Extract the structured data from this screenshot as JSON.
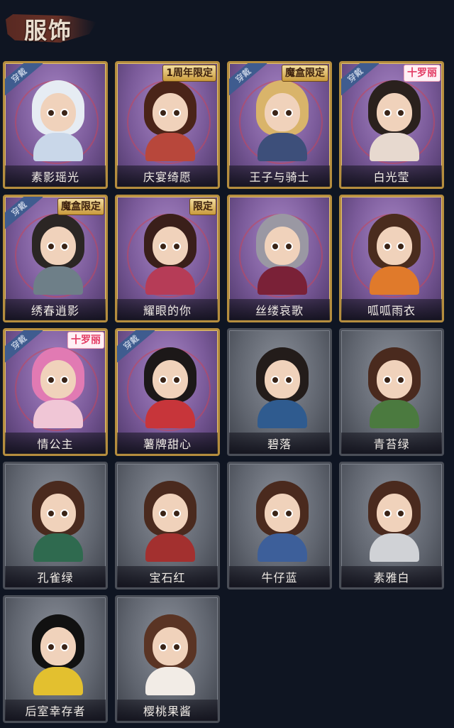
{
  "header": {
    "title": "服饰"
  },
  "labels": {
    "worn": "穿戴"
  },
  "colors": {
    "owned_frame": "#b58d3e",
    "locked_frame": "#4a4e57",
    "worn_ribbon": "#3f5c8f"
  },
  "costumes": [
    {
      "name": "素影瑶光",
      "worn": true,
      "tag": "",
      "state": "owned",
      "hair": "#e6ecf3",
      "body": "#c9d7e9"
    },
    {
      "name": "庆宴绮愿",
      "worn": false,
      "tag": "1周年限定",
      "state": "owned",
      "hair": "#4a2418",
      "body": "#b8473b"
    },
    {
      "name": "王子与骑士",
      "worn": true,
      "tag": "魔盒限定",
      "state": "owned",
      "hair": "#d9b46a",
      "body": "#3d4f7a"
    },
    {
      "name": "白光莹",
      "worn": true,
      "tag": "十罗丽",
      "state": "owned",
      "hair": "#2a211d",
      "body": "#e7d9cf"
    },
    {
      "name": "绣春逍影",
      "worn": true,
      "tag": "魔盒限定",
      "state": "owned",
      "hair": "#2b2624",
      "body": "#6e7f88"
    },
    {
      "name": "耀眼的你",
      "worn": false,
      "tag": "限定",
      "state": "owned",
      "hair": "#3a1f1a",
      "body": "#b63c57"
    },
    {
      "name": "丝缕哀歌",
      "worn": false,
      "tag": "",
      "state": "owned",
      "hair": "#9a98a3",
      "body": "#7a2137"
    },
    {
      "name": "呱呱雨衣",
      "worn": false,
      "tag": "",
      "state": "owned",
      "hair": "#4a2c1e",
      "body": "#e07a2b"
    },
    {
      "name": "情公主",
      "worn": true,
      "tag": "十罗丽",
      "state": "owned",
      "hair": "#e17ab3",
      "body": "#f0c6d6"
    },
    {
      "name": "薯牌甜心",
      "worn": true,
      "tag": "",
      "state": "owned",
      "hair": "#1c1818",
      "body": "#c7353a"
    },
    {
      "name": "碧落",
      "worn": false,
      "tag": "",
      "state": "locked",
      "hair": "#231c1a",
      "body": "#2f5b8f"
    },
    {
      "name": "青苔绿",
      "worn": false,
      "tag": "",
      "state": "locked",
      "hair": "#4a2a1e",
      "body": "#4b7a3f"
    },
    {
      "name": "孔雀绿",
      "worn": false,
      "tag": "",
      "state": "locked",
      "hair": "#4a2a1e",
      "body": "#2f6a4f"
    },
    {
      "name": "宝石红",
      "worn": false,
      "tag": "",
      "state": "locked",
      "hair": "#4a2a1e",
      "body": "#a3302f"
    },
    {
      "name": "牛仔蓝",
      "worn": false,
      "tag": "",
      "state": "locked",
      "hair": "#4a2a1e",
      "body": "#3d5f9a"
    },
    {
      "name": "素雅白",
      "worn": false,
      "tag": "",
      "state": "locked",
      "hair": "#4a2a1e",
      "body": "#d0d2d6"
    },
    {
      "name": "后室幸存者",
      "worn": false,
      "tag": "",
      "state": "locked",
      "hair": "#111111",
      "body": "#e3c02f"
    },
    {
      "name": "樱桃果酱",
      "worn": false,
      "tag": "",
      "state": "locked",
      "hair": "#5a3424",
      "body": "#f2ece6"
    }
  ]
}
